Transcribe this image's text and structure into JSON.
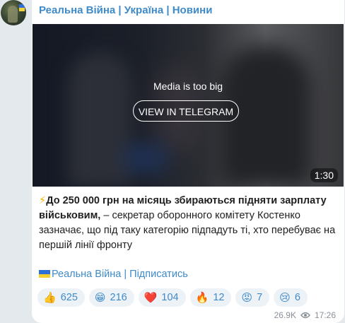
{
  "channel": {
    "name": "Реальна Війна | Україна | Новини"
  },
  "media": {
    "note": "Media is too big",
    "button": "VIEW IN TELEGRAM",
    "duration": "1:30"
  },
  "post": {
    "bolt": "⚡",
    "bold_text": "До 250 000 грн на місяць збираються підняти зарплату військовим,",
    "rest_text": " – секретар оборонного комітету Костенко зазначає, що під таку категорію підпадуть ті, хто перебуває на першій лінії фронту",
    "subscribe": "Реальна Війна | Підписатись"
  },
  "reactions": [
    {
      "icon": "thumbs-up",
      "emoji": "👍",
      "count": "625"
    },
    {
      "icon": "grinning-face",
      "emoji": "😁",
      "count": "216"
    },
    {
      "icon": "red-heart",
      "emoji": "❤️",
      "count": "104"
    },
    {
      "icon": "fire",
      "emoji": "🔥",
      "count": "12"
    },
    {
      "icon": "angry-face",
      "emoji": "😡",
      "count": "7"
    },
    {
      "icon": "crying-face",
      "emoji": "😢",
      "count": "6"
    }
  ],
  "meta": {
    "views": "26.9K",
    "time": "17:26"
  },
  "colors": {
    "link": "#3f8ac8",
    "background": "#e4e9ed",
    "bubble": "#ffffff",
    "reaction_bg": "#edf2f7"
  }
}
